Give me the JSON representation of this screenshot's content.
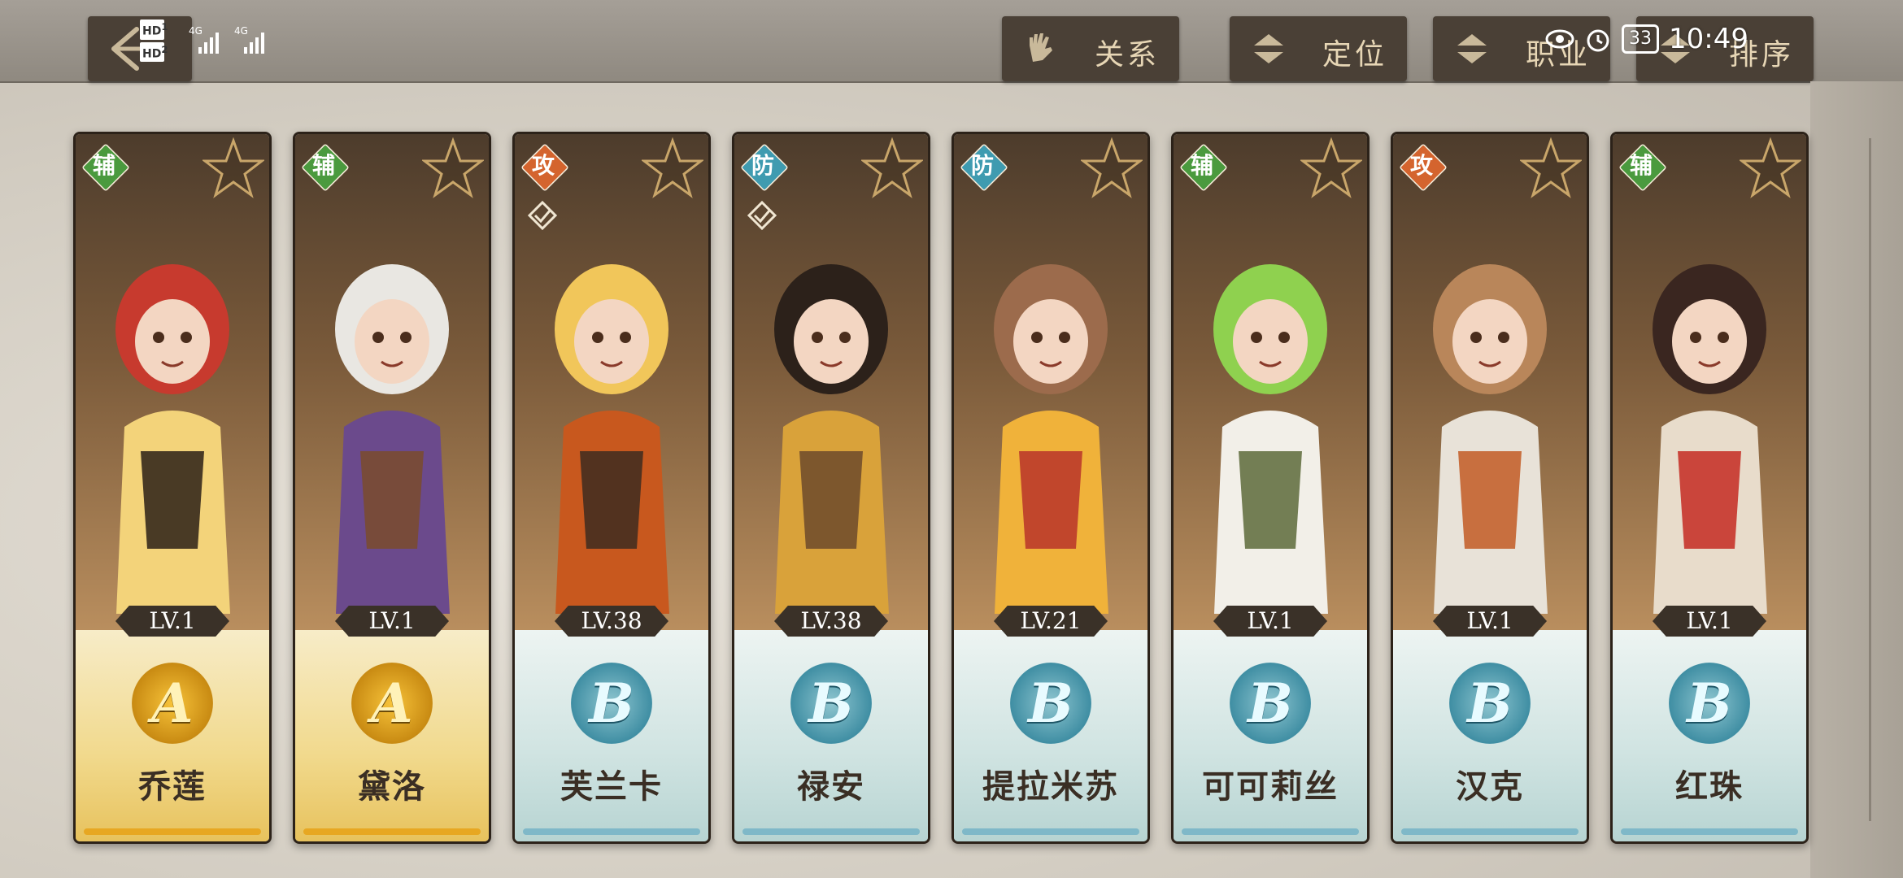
{
  "status_bar": {
    "sim1_label": "HD",
    "sim1_index": "1",
    "sim2_label": "HD",
    "sim2_index": "2",
    "net1": "4G",
    "net2": "4G",
    "battery": "33",
    "time": "10:49"
  },
  "header": {
    "back_icon": "arrow-left-icon",
    "filters": [
      {
        "label": "关系",
        "icon": "glove-icon"
      },
      {
        "label": "定位",
        "icon": "up-down-arrows-icon"
      },
      {
        "label": "职业",
        "icon": "up-down-arrows-icon"
      },
      {
        "label": "排序",
        "icon": "up-down-arrows-icon"
      }
    ]
  },
  "colors": {
    "role_support": "#4a9a3e",
    "role_attack": "#d4642e",
    "role_defense": "#3f9bb0",
    "gold_rarity": "#e7a722",
    "blue_rarity": "#7fb8c8"
  },
  "characters": [
    {
      "name": "乔莲",
      "role": "辅",
      "level": "LV.1",
      "grade": "A",
      "rarity": "gold",
      "star_icon": "star-icon"
    },
    {
      "name": "黛洛",
      "role": "辅",
      "level": "LV.1",
      "grade": "A",
      "rarity": "gold",
      "star_icon": "star-icon"
    },
    {
      "name": "芙兰卡",
      "role": "攻",
      "level": "LV.38",
      "grade": "B",
      "rarity": "blue",
      "star_icon": "star-icon",
      "check_icon": "check-icon"
    },
    {
      "name": "禄安",
      "role": "防",
      "level": "LV.38",
      "grade": "B",
      "rarity": "blue",
      "star_icon": "star-icon",
      "check_icon": "check-icon"
    },
    {
      "name": "提拉米苏",
      "role": "防",
      "level": "LV.21",
      "grade": "B",
      "rarity": "blue",
      "star_icon": "star-icon"
    },
    {
      "name": "可可莉丝",
      "role": "辅",
      "level": "LV.1",
      "grade": "B",
      "rarity": "blue",
      "star_icon": "star-icon"
    },
    {
      "name": "汉克",
      "role": "攻",
      "level": "LV.1",
      "grade": "B",
      "rarity": "blue",
      "star_icon": "star-icon"
    },
    {
      "name": "红珠",
      "role": "辅",
      "level": "LV.1",
      "grade": "B",
      "rarity": "blue",
      "star_icon": "star-icon"
    }
  ]
}
